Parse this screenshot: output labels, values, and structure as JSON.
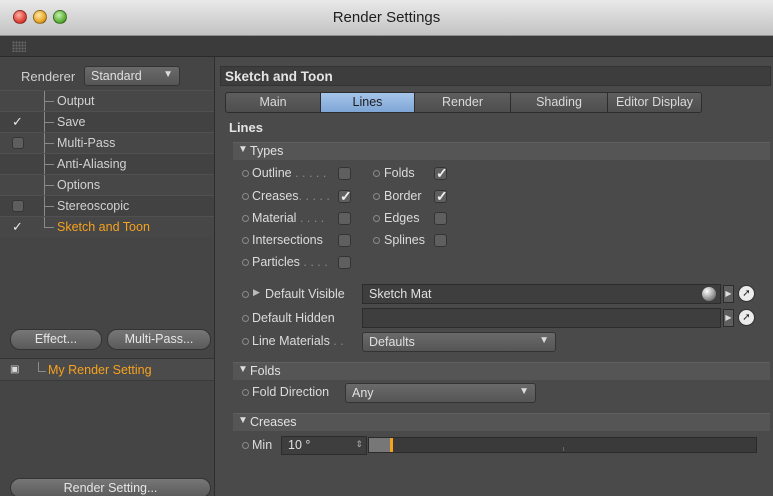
{
  "window": {
    "title": "Render Settings"
  },
  "left": {
    "renderer_label": "Renderer",
    "renderer_value": "Standard",
    "tree": [
      {
        "label": "Output",
        "check": "none"
      },
      {
        "label": "Save",
        "check": "on"
      },
      {
        "label": "Multi-Pass",
        "check": "off"
      },
      {
        "label": "Anti-Aliasing",
        "check": "none"
      },
      {
        "label": "Options",
        "check": "none"
      },
      {
        "label": "Stereoscopic",
        "check": "off"
      },
      {
        "label": "Sketch and Toon",
        "check": "on",
        "selected": true
      }
    ],
    "effect_button": "Effect...",
    "multipass_button": "Multi-Pass...",
    "setting_name": "My Render Setting",
    "render_setting_button": "Render Setting..."
  },
  "right": {
    "header": "Sketch and Toon",
    "tabs": [
      {
        "label": "Main",
        "active": false
      },
      {
        "label": "Lines",
        "active": true
      },
      {
        "label": "Render",
        "active": false
      },
      {
        "label": "Shading",
        "active": false
      },
      {
        "label": "Editor Display",
        "active": false
      }
    ],
    "section_title": "Lines",
    "types_group": "Types",
    "types": [
      {
        "label": "Outline",
        "dots": " . . . . .",
        "checked": false
      },
      {
        "label": "Folds",
        "dots": "",
        "checked": true
      },
      {
        "label": "Creases",
        "dots": ". . . . .",
        "checked": true
      },
      {
        "label": "Border",
        "dots": "",
        "checked": true
      },
      {
        "label": "Material",
        "dots": " . . . .",
        "checked": false
      },
      {
        "label": "Edges",
        "dots": "",
        "checked": false
      },
      {
        "label": "Intersections",
        "dots": "",
        "checked": false
      },
      {
        "label": "Splines",
        "dots": "",
        "checked": false
      },
      {
        "label": "Particles",
        "dots": " . . . .",
        "checked": false
      }
    ],
    "default_visible_label": "Default Visible",
    "default_visible_value": "Sketch Mat",
    "default_hidden_label": "Default Hidden",
    "default_hidden_value": "",
    "line_materials_label": "Line Materials",
    "line_materials_dots": " . .",
    "line_materials_value": "Defaults",
    "folds_group": "Folds",
    "fold_direction_label": "Fold Direction",
    "fold_direction_value": "Any",
    "creases_group": "Creases",
    "min_label": "Min",
    "min_value": "10 °",
    "min_fraction": 0.055
  },
  "colors": {
    "accent": "#f6a21e",
    "tab_active": "#8fb3e0"
  },
  "icons": [
    "close-icon",
    "minimize-icon",
    "zoom-icon",
    "checkmark-icon",
    "expand-triangle-icon",
    "material-sphere-icon",
    "picker-arrow-icon"
  ]
}
